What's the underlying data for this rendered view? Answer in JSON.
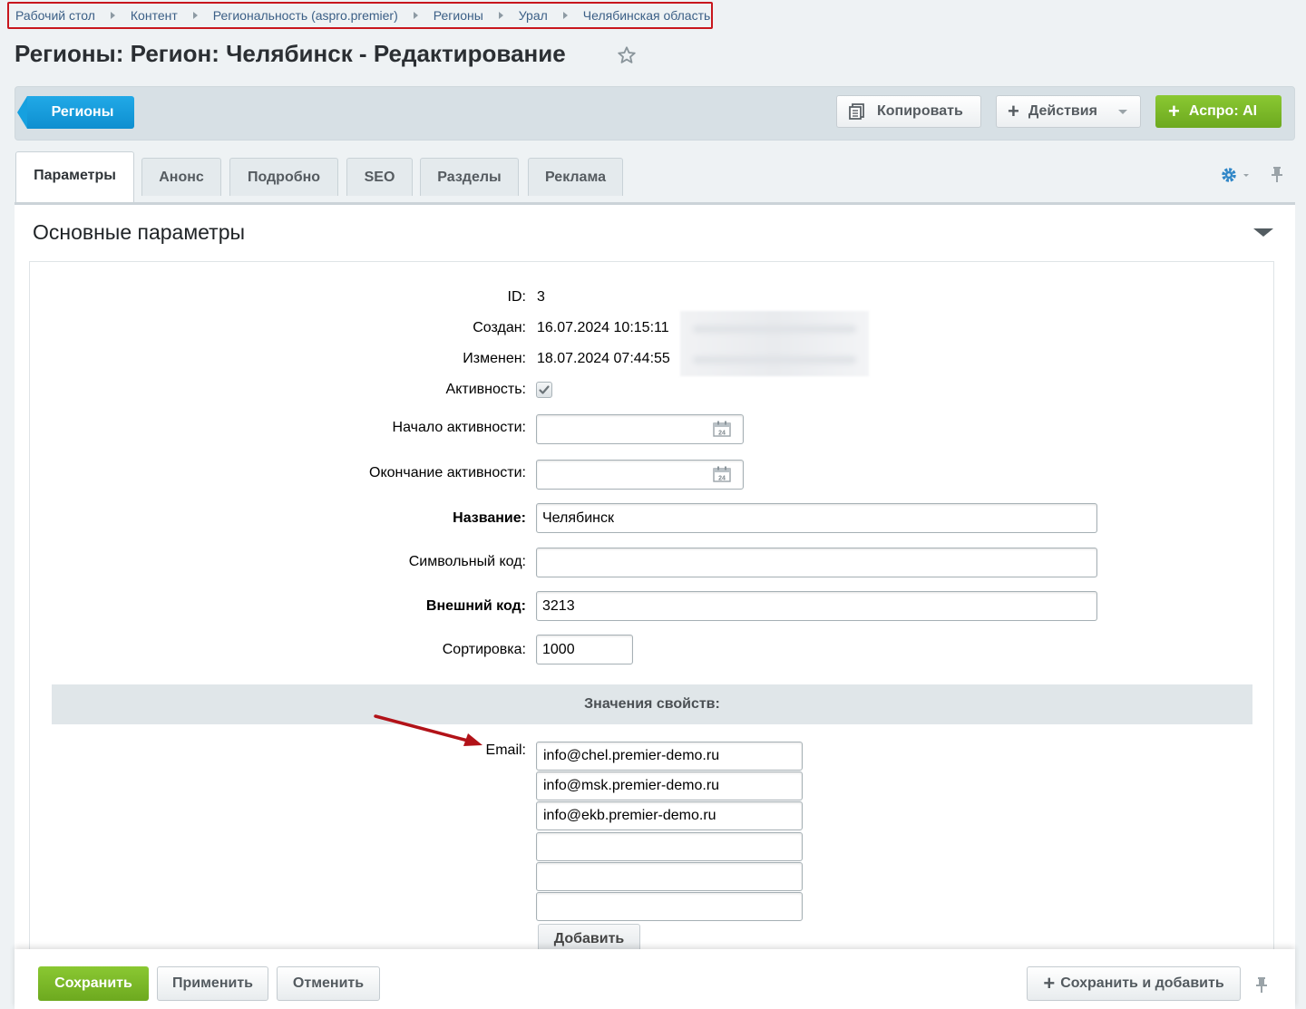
{
  "breadcrumb": [
    "Рабочий стол",
    "Контент",
    "Региональность (aspro.premier)",
    "Регионы",
    "Урал",
    "Челябинская область"
  ],
  "page_title": "Регионы: Регион: Челябинск - Редактирование",
  "toolbar": {
    "back_label": "Регионы",
    "copy_label": "Копировать",
    "actions_label": "Действия",
    "ai_label": "Аспро: AI"
  },
  "tabs": [
    "Параметры",
    "Анонс",
    "Подробно",
    "SEO",
    "Разделы",
    "Реклама"
  ],
  "section": {
    "title": "Основные параметры"
  },
  "fields": {
    "id_label": "ID:",
    "id_value": "3",
    "created_label": "Создан:",
    "created_value": "16.07.2024 10:15:11",
    "modified_label": "Изменен:",
    "modified_value": "18.07.2024 07:44:55",
    "active_label": "Активность:",
    "active_checked": true,
    "active_from_label": "Начало активности:",
    "active_from_value": "",
    "active_to_label": "Окончание активности:",
    "active_to_value": "",
    "name_label": "Название:",
    "name_value": "Челябинск",
    "code_label": "Символьный код:",
    "code_value": "",
    "xml_label": "Внешний код:",
    "xml_value": "3213",
    "sort_label": "Сортировка:",
    "sort_value": "1000"
  },
  "properties": {
    "header": "Значения свойств:",
    "email_label": "Email:",
    "emails": [
      "info@chel.premier-demo.ru",
      "info@msk.premier-demo.ru",
      "info@ekb.premier-demo.ru",
      "",
      "",
      ""
    ],
    "add_label": "Добавить"
  },
  "footer": {
    "save_label": "Сохранить",
    "apply_label": "Применить",
    "cancel_label": "Отменить",
    "save_add_label": "Сохранить и добавить"
  },
  "colors": {
    "accent_blue": "#0e8fd0",
    "accent_green": "#7ab828",
    "highlight_red": "#c8161d"
  }
}
